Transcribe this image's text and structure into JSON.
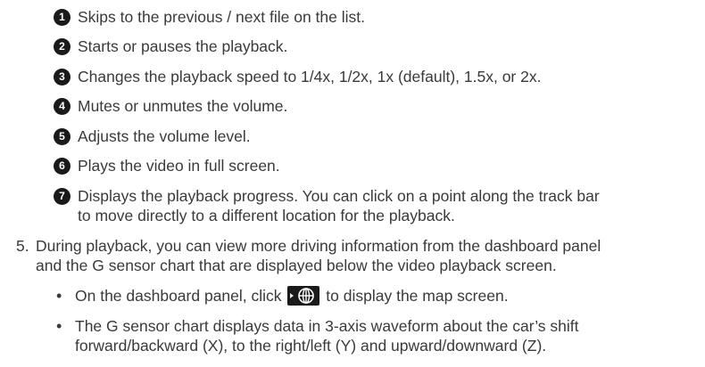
{
  "callouts": [
    {
      "num": "1",
      "text": "Skips to the previous / next file on the list."
    },
    {
      "num": "2",
      "text": "Starts or pauses the playback."
    },
    {
      "num": "3",
      "text": "Changes the playback speed to 1/4x, 1/2x, 1x (default), 1.5x, or 2x."
    },
    {
      "num": "4",
      "text": "Mutes or unmutes the volume."
    },
    {
      "num": "5",
      "text": "Adjusts the volume level."
    },
    {
      "num": "6",
      "text": "Plays the video in full screen."
    },
    {
      "num": "7",
      "text_line1": "Displays the playback progress. You can click on a point along the track bar",
      "text_line2": "to move directly to a different location for the playback."
    }
  ],
  "step5": {
    "number": "5.",
    "line1": "During playback, you can view more driving information from the dashboard panel",
    "line2": "and the G sensor chart that are displayed below the video playback screen."
  },
  "bullets": {
    "b1_before": "On the dashboard panel, click",
    "b1_icon": "map-globe-icon",
    "b1_after": "to display the map screen.",
    "b2_line1": "The G sensor chart displays data in 3-axis waveform about the car’s shift",
    "b2_line2": "forward/backward (X), to the right/left (Y) and upward/downward (Z)."
  },
  "colors": {
    "text": "#3a3a3a",
    "badge": "#1a1a1a",
    "icon_bg": "#1a1a1a"
  }
}
